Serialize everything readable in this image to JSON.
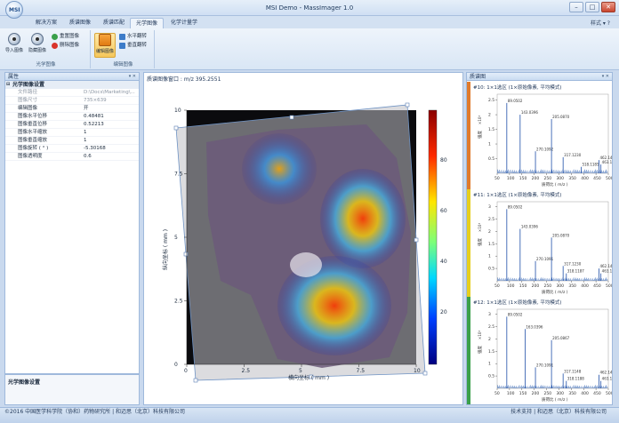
{
  "window": {
    "title": "MSI Demo - MassImager 1.0",
    "logo": "MSI",
    "controls": [
      "–",
      "□",
      "✕"
    ]
  },
  "ribbon": {
    "tabs": [
      "解决方案",
      "质谱图像",
      "质谱匹配",
      "光学图像",
      "化学计量学"
    ],
    "active_tab": "光学图像",
    "style_menu": "样式 ▾ ?",
    "groups": [
      {
        "label": "光学图像",
        "buttons": [
          {
            "label": "导入图像"
          },
          {
            "label": "隐藏图像"
          }
        ],
        "small": [
          {
            "label": "重置图像",
            "color": "#3aa04a"
          },
          {
            "label": "删除图像",
            "color": "#d9342b"
          }
        ]
      },
      {
        "label": "编辑图像",
        "buttons": [
          {
            "label": "编辑图像"
          }
        ],
        "small": [
          {
            "label": "水平翻转",
            "color": "#3d7cc9"
          },
          {
            "label": "垂直翻转",
            "color": "#3d7cc9"
          }
        ]
      }
    ]
  },
  "properties": {
    "title": "属性",
    "pin": "▾ ✕",
    "category": "光学图像设置",
    "rows": [
      {
        "name": "文件路径",
        "value": "D:\\Docs\\Marketing\\...",
        "readonly": true
      },
      {
        "name": "图像尺寸",
        "value": "735×639",
        "readonly": true
      },
      {
        "name": "编辑图像",
        "value": "开",
        "readonly": false
      },
      {
        "name": "图像水平位移",
        "value": "0.48481",
        "readonly": false
      },
      {
        "name": "图像垂直位移",
        "value": "0.52213",
        "readonly": false
      },
      {
        "name": "图像水平缩放",
        "value": "1",
        "readonly": false
      },
      {
        "name": "图像垂直缩放",
        "value": "1",
        "readonly": false
      },
      {
        "name": "图像旋转 ( ° )",
        "value": "-5.30168",
        "readonly": false
      },
      {
        "name": "图像透明度",
        "value": "0.6",
        "readonly": false
      }
    ],
    "description": "光学图像设置"
  },
  "viewer": {
    "title": "质谱图像窗口 : m/z 395.2551",
    "xlabel": "横向坐标 ( mm )",
    "ylabel": "纵向坐标 ( mm )",
    "xticks": [
      "0",
      "2.5",
      "5",
      "7.5",
      "10"
    ],
    "yticks": [
      "0",
      "2.5",
      "5",
      "7.5",
      "10"
    ],
    "colorbar_ticks": [
      "80",
      "60",
      "40",
      "20"
    ]
  },
  "spectra": {
    "title": "质谱图",
    "pin": "▾ ✕",
    "xlabel": "质荷比 ( m/z )",
    "ylabel": "强度",
    "xticks": [
      "50",
      "100",
      "150",
      "200",
      "250",
      "300",
      "350",
      "400",
      "450",
      "500"
    ],
    "items": [
      {
        "title": "#10: 1×1选区 (1×原始像素, 平均模式)",
        "color": "#e07a2b",
        "exponent": "×10⁴",
        "yticks": [
          "2.5",
          "2",
          "1.5",
          "1",
          "0.5"
        ],
        "ymax": 2.7,
        "labels": [
          "89.0502",
          "143.0396",
          "270.1092",
          "205.0870",
          "317.1230",
          "518.1185",
          "462.1403",
          "463.1"
        ],
        "peaks": [
          [
            89,
            2.4
          ],
          [
            143,
            2.0
          ],
          [
            205,
            0.75
          ],
          [
            270,
            1.85
          ],
          [
            317,
            0.55
          ],
          [
            390,
            0.22
          ],
          [
            462,
            0.45
          ],
          [
            470,
            0.3
          ]
        ]
      },
      {
        "title": "#11: 1×1选区 (1×原始像素, 平均模式)",
        "color": "#e6cf1f",
        "exponent": "×10⁴",
        "yticks": [
          "3",
          "2.5",
          "2",
          "1.5",
          "1",
          "0.5"
        ],
        "ymax": 3.2,
        "labels": [
          "89.0502",
          "143.0396",
          "270.1091",
          "205.0870",
          "317.1230",
          "318.1187",
          "462.1405",
          "463.1"
        ],
        "peaks": [
          [
            89,
            2.9
          ],
          [
            143,
            2.1
          ],
          [
            205,
            0.8
          ],
          [
            270,
            1.75
          ],
          [
            317,
            0.6
          ],
          [
            330,
            0.3
          ],
          [
            462,
            0.5
          ],
          [
            470,
            0.3
          ]
        ]
      },
      {
        "title": "#12: 1×1选区 (1×原始像素, 平均模式)",
        "color": "#3aa04a",
        "exponent": "×10⁴",
        "yticks": [
          "3",
          "2.5",
          "2",
          "1.5",
          "1",
          "0.5"
        ],
        "ymax": 3.2,
        "labels": [
          "89.0502",
          "163.0396",
          "270.1091",
          "205.0867",
          "317.1148",
          "318.1188",
          "462.1403",
          "463.1"
        ],
        "peaks": [
          [
            89,
            2.9
          ],
          [
            163,
            2.4
          ],
          [
            205,
            0.85
          ],
          [
            270,
            1.95
          ],
          [
            317,
            0.6
          ],
          [
            330,
            0.3
          ],
          [
            462,
            0.55
          ],
          [
            470,
            0.3
          ]
        ]
      }
    ]
  },
  "status": {
    "left": "©2016 中国医学科学院（协和）药物研究所 | 和迈思（北京）科技有限公司",
    "right": "技术支持 | 和迈思（北京）科技有限公司"
  }
}
